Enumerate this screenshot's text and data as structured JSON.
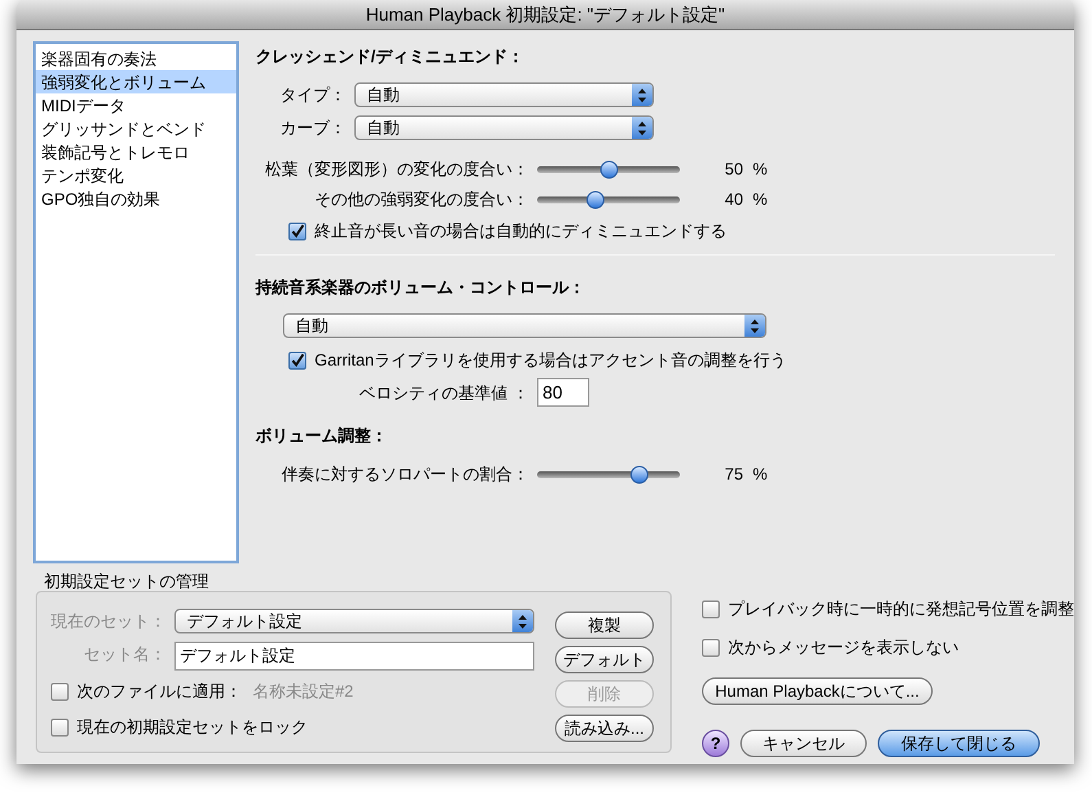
{
  "window": {
    "title": "Human Playback 初期設定: \"デフォルト設定\""
  },
  "sidebar": {
    "items": [
      {
        "label": "楽器固有の奏法",
        "selected": false
      },
      {
        "label": "強弱変化とボリューム",
        "selected": true
      },
      {
        "label": "MIDIデータ",
        "selected": false
      },
      {
        "label": "グリッサンドとベンド",
        "selected": false
      },
      {
        "label": "装飾記号とトレモロ",
        "selected": false
      },
      {
        "label": "テンポ変化",
        "selected": false
      },
      {
        "label": "GPO独自の効果",
        "selected": false
      }
    ]
  },
  "crescendo": {
    "heading": "クレッシェンド/ディミニュエンド：",
    "popups": [
      {
        "label": "タイプ：",
        "value": "自動"
      },
      {
        "label": "カーブ：",
        "value": "自動"
      }
    ],
    "sliders": [
      {
        "label": "松葉（変形図形）の変化の度合い：",
        "level": 0.5,
        "reading": "50",
        "unit": "%"
      },
      {
        "label": "その他の強弱変化の度合い：",
        "level": 0.4,
        "reading": "40",
        "unit": "%"
      }
    ],
    "checkbox": {
      "label": "終止音が長い音の場合は自動的にディミニュエンドする",
      "checked": true
    }
  },
  "sustain": {
    "heading": "持続音系楽器のボリューム・コントロール：",
    "popup": {
      "value": "自動"
    },
    "checkbox": {
      "label": "Garritanライブラリを使用する場合はアクセント音の調整を行う",
      "checked": true
    },
    "velocity": {
      "label": "ベロシティの基準値 ：",
      "value": "80"
    }
  },
  "volume": {
    "heading": "ボリューム調整：",
    "sliders": [
      {
        "label": "伴奏に対するソロパートの割合：",
        "level": 0.75,
        "reading": "75",
        "unit": "%"
      }
    ]
  },
  "preset_management": {
    "heading": "初期設定セットの管理",
    "current_set": {
      "label": "現在のセット：",
      "value": "デフォルト設定"
    },
    "set_name": {
      "label": "セット名：",
      "value": "デフォルト設定"
    },
    "apply_file": {
      "label": "次のファイルに適用：",
      "checked": false,
      "value": "名称未設定#2"
    },
    "lock": {
      "label": "現在の初期設定セットをロック",
      "checked": false
    },
    "buttons": [
      {
        "label": "複製",
        "disabled": false
      },
      {
        "label": "デフォルト",
        "disabled": false
      },
      {
        "label": "削除",
        "disabled": true
      },
      {
        "label": "読み込み...",
        "disabled": false
      }
    ]
  },
  "options": [
    {
      "label": "プレイバック時に一時的に発想記号位置を調整",
      "checked": false
    },
    {
      "label": "次からメッセージを表示しない",
      "checked": false
    }
  ],
  "about_button": {
    "label": "Human Playbackについて..."
  },
  "help_button": {
    "label": "?"
  },
  "footer_buttons": [
    {
      "label": "キャンセル",
      "default": false
    },
    {
      "label": "保存して閉じる",
      "default": true
    }
  ]
}
